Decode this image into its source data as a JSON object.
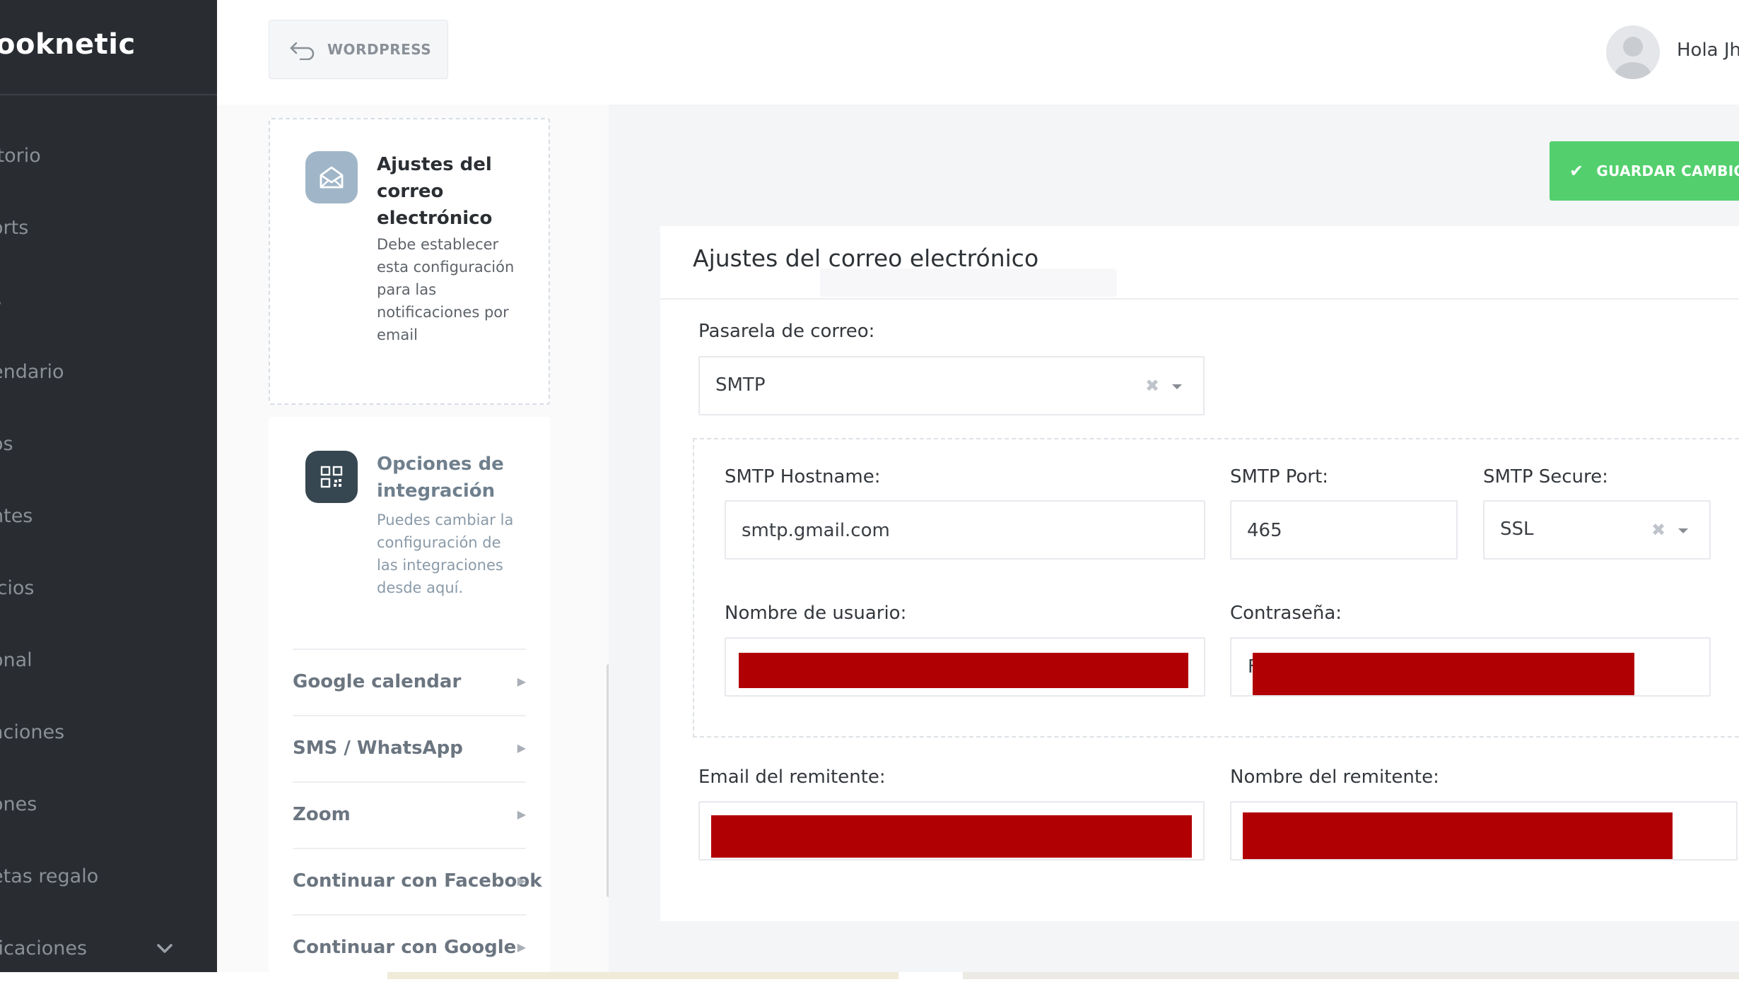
{
  "sidebar": {
    "brand": "ooknetic",
    "items": [
      {
        "label": "itorio"
      },
      {
        "label": "orts"
      },
      {
        "label": "s"
      },
      {
        "label": "endario"
      },
      {
        "label": "os"
      },
      {
        "label": "ntes"
      },
      {
        "label": "icios"
      },
      {
        "label": "onal"
      },
      {
        "label": "aciones"
      },
      {
        "label": "ones"
      },
      {
        "label": "etas regalo"
      },
      {
        "label": "ficaciones"
      }
    ]
  },
  "topbar": {
    "back_button_label": "WORDPRESS",
    "greeting": "Hola Jh"
  },
  "settings_nav": {
    "email_card": {
      "title": "Ajustes del correo electrónico",
      "description": "Debe establecer esta configuración para las notificaciones por email"
    },
    "integration_card": {
      "title": "Opciones de integración",
      "description": "Puedes cambiar la configuración de las integraciones desde aquí."
    },
    "integrations": [
      {
        "label": "Google calendar"
      },
      {
        "label": "SMS / WhatsApp"
      },
      {
        "label": "Zoom"
      },
      {
        "label": "Continuar con Facebook"
      },
      {
        "label": "Continuar con Google"
      }
    ]
  },
  "actions": {
    "save_label": "GUARDAR CAMBIO"
  },
  "form": {
    "title": "Ajustes del correo electrónico",
    "mail_gateway": {
      "label": "Pasarela de correo:",
      "value": "SMTP"
    },
    "smtp_hostname": {
      "label": "SMTP Hostname:",
      "value": "smtp.gmail.com"
    },
    "smtp_port": {
      "label": "SMTP Port:",
      "value": "465"
    },
    "smtp_secure": {
      "label": "SMTP Secure:",
      "value": "SSL"
    },
    "username": {
      "label": "Nombre de usuario:"
    },
    "password": {
      "label": "Contraseña:",
      "visible_prefix": "F"
    },
    "sender_email": {
      "label": "Email del remitente:"
    },
    "sender_name": {
      "label": "Nombre del remitente:"
    }
  },
  "colors": {
    "sidebar_bg": "#292d32",
    "save_button": "#53d06d",
    "redaction": "#b10004",
    "mail_icon_bg": "#a0b6c8",
    "integration_icon_bg": "#374751"
  },
  "icons": {
    "back": "undo-arrow-icon",
    "mail": "envelope-open-icon",
    "integration": "qr-grid-icon",
    "check": "checkmark-icon",
    "chevron": "chevron-down-icon",
    "clear": "clear-x-icon",
    "caret": "caret-down-icon",
    "arrow": "caret-right-icon"
  }
}
